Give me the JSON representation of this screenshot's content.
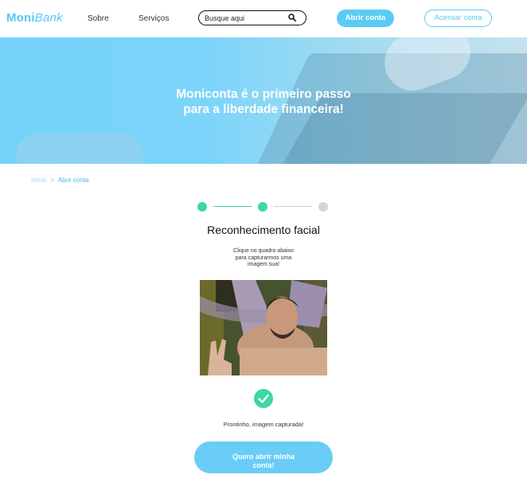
{
  "header": {
    "logo_part1": "Moni",
    "logo_part2": "Bank",
    "nav": [
      "Sobre",
      "Serviços"
    ],
    "search_placeholder": "Busque aqui",
    "open_account_label": "Abrir conta",
    "access_account_label": "Acessar conta"
  },
  "banner": {
    "headline_line1": "Moniconta é o primeiro passo",
    "headline_line2": "para a liberdade financeira!"
  },
  "breadcrumb": {
    "home": "Início",
    "separator": ">",
    "current": "Abrir conta"
  },
  "steps": {
    "total": 3,
    "completed": 2
  },
  "main": {
    "title": "Reconhecimento facial",
    "instruction": "Clique no quadro abaixo para capturarmos uma imagem sua!",
    "status_text": "Prontinho, imagem capturada!",
    "cta_label": "Quero abrir minha conta!"
  },
  "colors": {
    "accent": "#5bcbf5",
    "success": "#3ed6a6",
    "pending": "#d6d6d6"
  },
  "icons": {
    "search": "search-icon",
    "check": "check-icon"
  }
}
